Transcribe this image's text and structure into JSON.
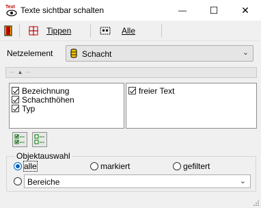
{
  "window": {
    "title": "Texte sichtbar schalten",
    "icon_text": "Text",
    "minimize_glyph": "—",
    "maximize_glyph": "☐",
    "close_glyph": "✕"
  },
  "toolbar": {
    "tippen_label": "Tippen",
    "alle_label": "Alle"
  },
  "netzelement": {
    "label": "Netzelement",
    "value": "Schacht"
  },
  "lists": {
    "left": [
      "Bezeichnung",
      "Schachthöhen",
      "Typ"
    ],
    "right": [
      "freier Text"
    ]
  },
  "objektauswahl": {
    "title": "Objektauswahl",
    "options": [
      "alle",
      "markiert",
      "gefiltert"
    ],
    "selected": "alle",
    "bereiche_value": "Bereiche"
  },
  "colors": {
    "accent": "#0060c0",
    "icon_red": "#c00000",
    "icon_green": "#1a8a1a",
    "icon_yellow": "#f5c400"
  }
}
